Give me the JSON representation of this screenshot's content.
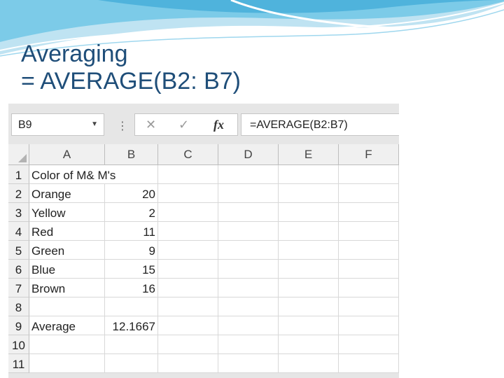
{
  "slide": {
    "title_line1": "Averaging",
    "title_line2": "= AVERAGE(B2: B7)"
  },
  "excel": {
    "name_box": "B9",
    "formula": "=AVERAGE(B2:B7)",
    "icons": {
      "cancel": "x-icon",
      "enter": "check-icon",
      "function": "fx-icon",
      "dropdown": "chevron-down-icon"
    },
    "columns": [
      "A",
      "B",
      "C",
      "D",
      "E",
      "F"
    ],
    "rows": [
      {
        "num": "1",
        "a": "Color of M& M's",
        "b": ""
      },
      {
        "num": "2",
        "a": "Orange",
        "b": "20"
      },
      {
        "num": "3",
        "a": "Yellow",
        "b": "2"
      },
      {
        "num": "4",
        "a": "Red",
        "b": "11"
      },
      {
        "num": "5",
        "a": "Green",
        "b": "9"
      },
      {
        "num": "6",
        "a": "Blue",
        "b": "15"
      },
      {
        "num": "7",
        "a": "Brown",
        "b": "16"
      },
      {
        "num": "8",
        "a": "",
        "b": ""
      },
      {
        "num": "9",
        "a": "Average",
        "b": "12.1667"
      },
      {
        "num": "10",
        "a": "",
        "b": ""
      },
      {
        "num": "11",
        "a": "",
        "b": ""
      }
    ]
  }
}
